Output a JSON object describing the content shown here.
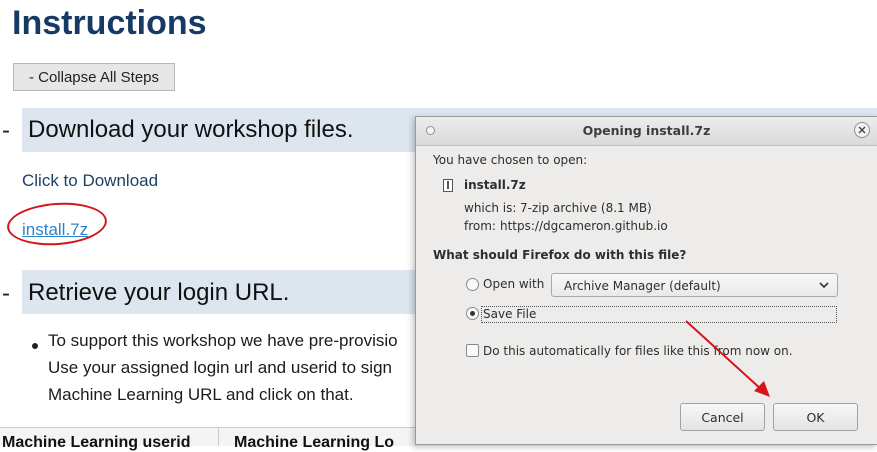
{
  "page": {
    "title": "Instructions",
    "collapse_button": "- Collapse All Steps",
    "step_marker": "-",
    "steps": [
      {
        "heading": "Download your workshop files."
      },
      {
        "heading": "Retrieve your login URL."
      }
    ],
    "click_to_download": "Click to Download",
    "download_link": "install.7z",
    "bullet_lines": [
      "To support this workshop we have pre-provisio",
      "Use your assigned login url and userid to sign",
      "Machine Learning URL and click on that."
    ],
    "table_headers": [
      "Machine Learning userid",
      "Machine Learning Lo"
    ]
  },
  "dialog": {
    "title": "Opening install.7z",
    "chosen_label": "You have chosen to open:",
    "filename": "install.7z",
    "which_is_label": "which is:",
    "which_is_value": "7-zip archive (8.1 MB)",
    "from_label": "from:",
    "from_value": "https://dgcameron.github.io",
    "question": "What should Firefox do with this file?",
    "open_with_label": "Open with",
    "open_with_app": "Archive Manager (default)",
    "save_file_label": "Save File",
    "save_file_selected": true,
    "auto_label": "Do this automatically for files like this from now on.",
    "auto_checked": false,
    "cancel_label": "Cancel",
    "ok_label": "OK"
  },
  "icons": [
    "file-icon",
    "close-icon",
    "chevron-down-icon",
    "arrow-annotation"
  ],
  "colors": {
    "title_blue": "#163a63",
    "link_blue": "#2f84c6",
    "annotation_red": "#d4151c",
    "step_bar": "#dde6ef"
  }
}
